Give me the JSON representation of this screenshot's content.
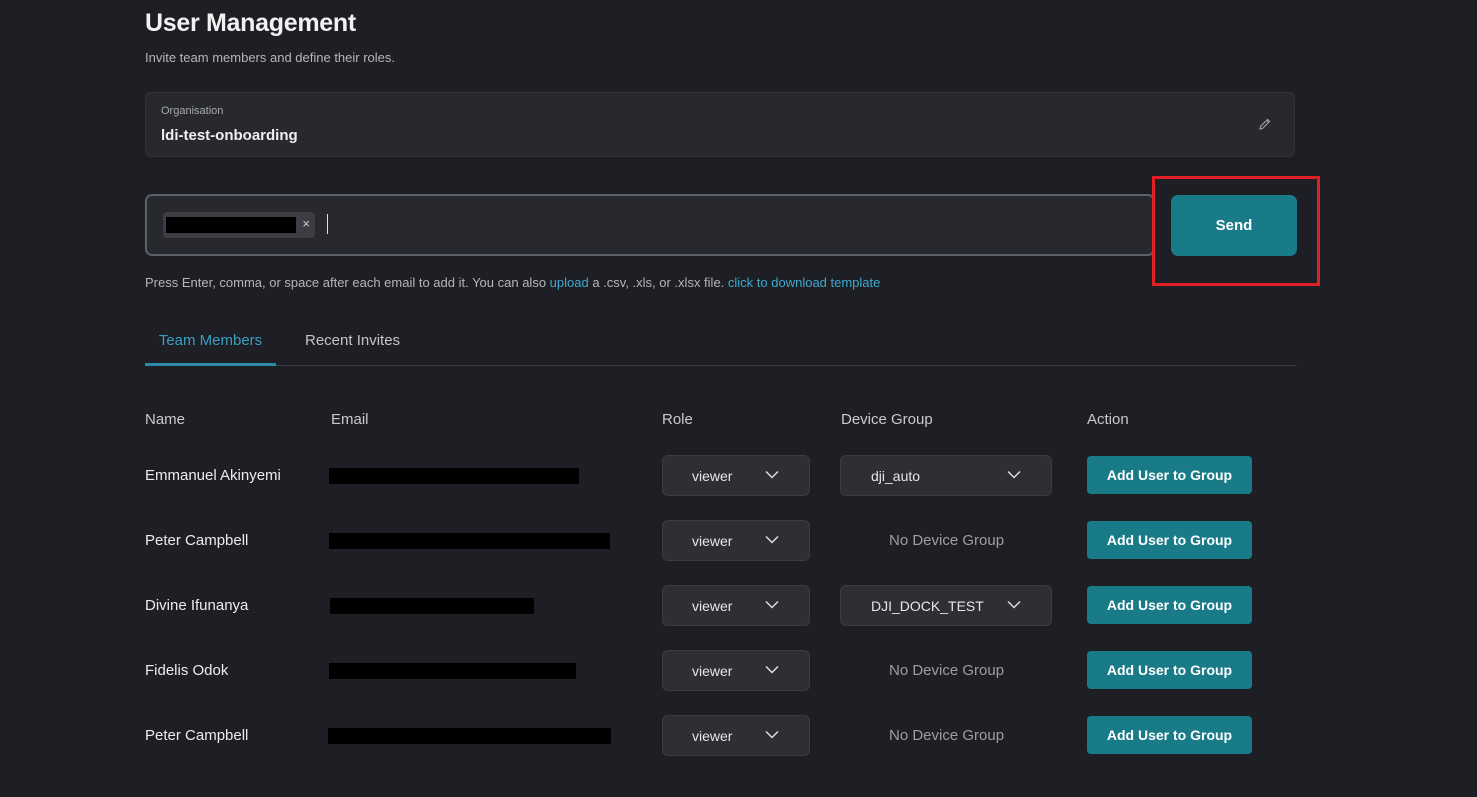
{
  "page": {
    "title": "User Management",
    "subtitle": "Invite team members and define their roles."
  },
  "organisation": {
    "label": "Organisation",
    "value": "ldi-test-onboarding",
    "edit_icon": "pencil-icon"
  },
  "invite": {
    "chip_remove": "×",
    "send_label": "Send",
    "helper_prefix": "Press Enter, comma, or space after each email to add it. You can also ",
    "helper_upload": "upload",
    "helper_middle": " a .csv, .xls, or .xlsx file. ",
    "helper_template": "click to download template"
  },
  "tabs": [
    {
      "label": "Team Members",
      "active": true
    },
    {
      "label": "Recent Invites",
      "active": false
    }
  ],
  "table": {
    "headers": [
      "Name",
      "Email",
      "Role",
      "Device Group",
      "Action"
    ],
    "rows": [
      {
        "name": "Emmanuel Akinyemi",
        "role": "viewer",
        "device_group": "dji_auto",
        "has_group": true,
        "action": "Add User to Group"
      },
      {
        "name": "Peter Campbell",
        "role": "viewer",
        "device_group": "No Device Group",
        "has_group": false,
        "action": "Add User to Group"
      },
      {
        "name": "Divine Ifunanya",
        "role": "viewer",
        "device_group": "DJI_DOCK_TEST",
        "has_group": true,
        "action": "Add User to Group"
      },
      {
        "name": "Fidelis Odok",
        "role": "viewer",
        "device_group": "No Device Group",
        "has_group": false,
        "action": "Add User to Group"
      },
      {
        "name": "Peter Campbell",
        "role": "viewer",
        "device_group": "No Device Group",
        "has_group": false,
        "action": "Add User to Group"
      }
    ]
  },
  "colors": {
    "background": "#1e1f24",
    "accent": "#1a7b88",
    "link": "#3fa9d0",
    "highlight": "#e01f26"
  }
}
